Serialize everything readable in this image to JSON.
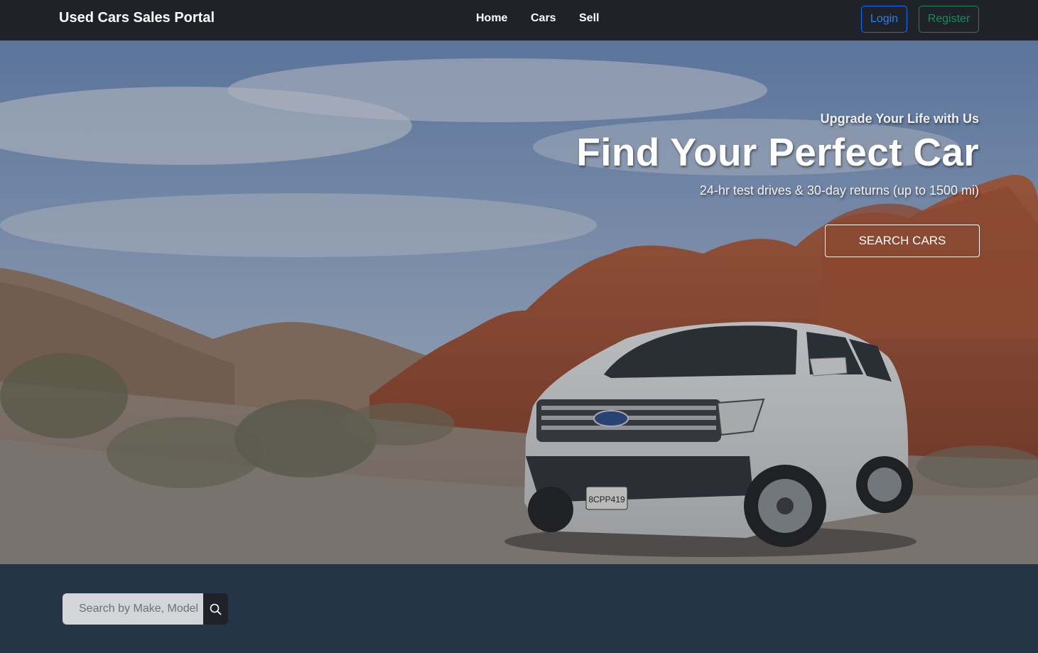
{
  "navbar": {
    "brand": "Used Cars Sales Portal",
    "links": [
      {
        "label": "Home"
      },
      {
        "label": "Cars"
      },
      {
        "label": "Sell"
      }
    ],
    "login_label": "Login",
    "register_label": "Register",
    "login_color": "#0d6efd",
    "register_color": "#198754"
  },
  "hero": {
    "kicker": "Upgrade Your Life with Us",
    "title": "Find Your Perfect Car",
    "subtitle": "24-hr test drives & 30-day returns (up to 1500 mi)",
    "cta_label": "SEARCH CARS",
    "background": "desert-road-suv-photo",
    "plate_text": "8CPP419"
  },
  "search": {
    "placeholder": "Search by Make, Model",
    "icon": "search-icon"
  },
  "colors": {
    "navbar_bg": "#1f2329",
    "section_bg": "#253446"
  }
}
